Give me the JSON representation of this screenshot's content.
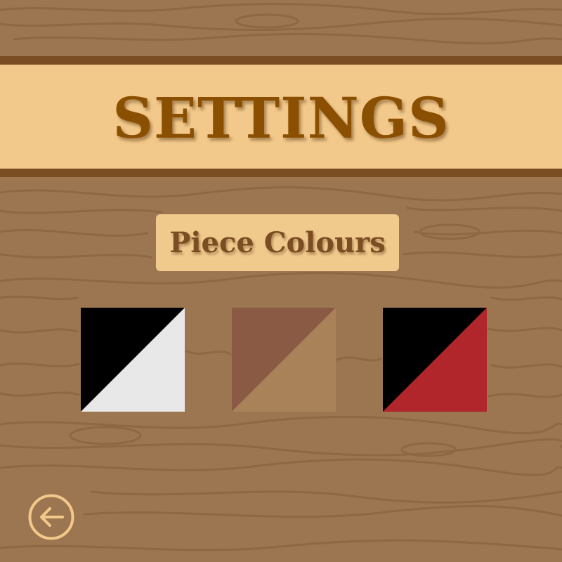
{
  "header": {
    "title": "SETTINGS"
  },
  "piece_colours": {
    "label": "Piece Colours",
    "options": [
      {
        "primary": "#000000",
        "secondary": "#e8e8e8"
      },
      {
        "primary": "#8b5a45",
        "secondary": "#a9825a"
      },
      {
        "primary": "#000000",
        "secondary": "#b0262a"
      }
    ]
  },
  "colors": {
    "wood": "#9b7650",
    "banner": "#f3c98b",
    "banner_border": "#7a4d22",
    "title_text": "#8a4f00",
    "label_text": "#7a4d22",
    "back_icon": "#f3c98b"
  },
  "back": {
    "icon": "arrow-left-circle-icon"
  }
}
